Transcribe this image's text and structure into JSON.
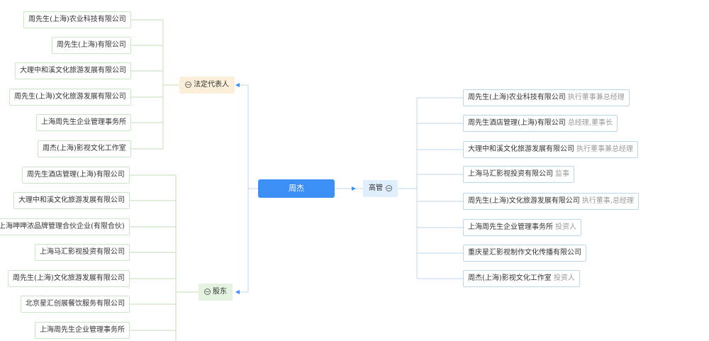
{
  "root": {
    "name": "周杰"
  },
  "legal_rep": {
    "label": "法定代表人",
    "companies": [
      "周先生(上海)农业科技有限公司",
      "周先生(上海)有限公司",
      "大理中和溪文化旅游发展有限公司",
      "周先生(上海)文化旅游发展有限公司",
      "上海周先生企业管理事务所",
      "周杰(上海)影视文化工作室"
    ]
  },
  "shareholder": {
    "label": "股东",
    "companies": [
      "周先生酒店管理(上海)有限公司",
      "大理中和溪文化旅游发展有限公司",
      "上海呷呷浓品牌管理合伙企业(有限合伙)",
      "上海马汇影视投资有限公司",
      "周先生(上海)文化旅游发展有限公司",
      "北京星汇创展餐饮服务有限公司",
      "上海周先生企业管理事务所"
    ]
  },
  "executive": {
    "label": "高管",
    "items": [
      {
        "company": "周先生(上海)农业科技有限公司",
        "role": "执行董事兼总经理"
      },
      {
        "company": "周先生酒店管理(上海)有限公司",
        "role": "总经理,董事长"
      },
      {
        "company": "大理中和溪文化旅游发展有限公司",
        "role": "执行董事兼总经理"
      },
      {
        "company": "上海马汇影视投资有限公司",
        "role": "监事"
      },
      {
        "company": "周先生(上海)文化旅游发展有限公司",
        "role": "执行董事,总经理"
      },
      {
        "company": "上海周先生企业管理事务所",
        "role": "投资人"
      },
      {
        "company": "重庆星汇影视制作文化传播有限公司",
        "role": ""
      },
      {
        "company": "周杰(上海)影视文化工作室",
        "role": "投资人"
      }
    ]
  },
  "colors": {
    "root": "#3c8ff5",
    "legal_rep_bg": "#fcefd9",
    "shareholder_bg": "#e3f3df",
    "executive_bg": "#dfeefb",
    "left_line": "#c5dcb8",
    "right_line": "#bcd6ee",
    "arrow": "#3c8ff5"
  }
}
